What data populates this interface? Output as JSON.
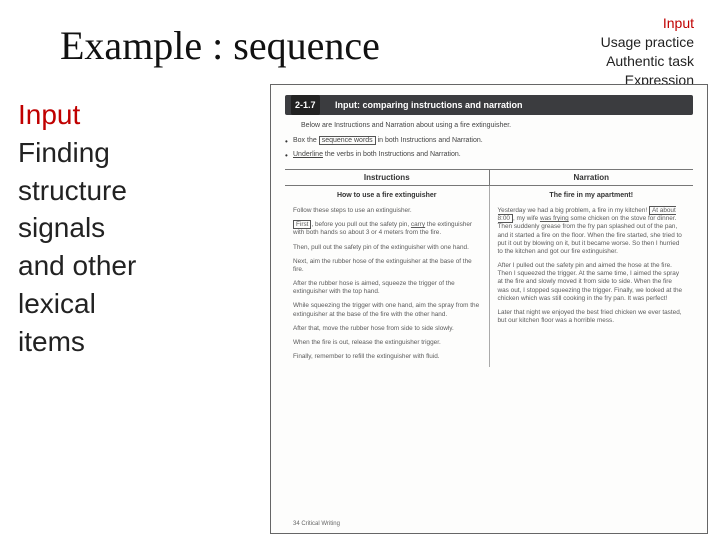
{
  "title": "Example : sequence",
  "corner": {
    "l1": "Input",
    "l2": "Usage practice",
    "l3": "Authentic task",
    "l4": "Expression"
  },
  "left": {
    "l1": "Input",
    "l2": "Finding",
    "l3": "structure",
    "l4": "signals",
    "l5": "and other",
    "l6": "lexical",
    "l7": "items"
  },
  "scan": {
    "code": "2-1.7",
    "bar_title": "Input: comparing instructions and narration",
    "intro": "Below are Instructions and Narration about using a fire extinguisher.",
    "bullet1_a": "Box the ",
    "bullet1_b": "sequence words",
    "bullet1_c": " in both Instructions and Narration.",
    "bullet2_a": "Underline",
    "bullet2_b": " the verbs in both Instructions and Narration.",
    "head_left": "Instructions",
    "head_right": "Narration",
    "sub_left": "How to use a fire extinguisher",
    "sub_right": "The fire in my apartment!",
    "left_p1": "Follow these steps to use an extinguisher.",
    "left_p2a": "First",
    "left_p2b": ", before you pull out the safety pin, ",
    "left_p2c": "carry",
    "left_p2d": " the extinguisher with both hands so about 3 or 4 meters from the fire.",
    "left_p3": "Then, pull out the safety pin of the extinguisher with one hand.",
    "left_p4": "Next, aim the rubber hose of the extinguisher at the base of the fire.",
    "left_p5": "After the rubber hose is aimed, squeeze the trigger of the extinguisher with the top hand.",
    "left_p6": "While squeezing the trigger with one hand, aim the spray from the extinguisher at the base of the fire with the other hand.",
    "left_p7": "After that, move the rubber hose from side to side slowly.",
    "left_p8": "When the fire is out, release the extinguisher trigger.",
    "left_p9": "Finally, remember to refill the extinguisher with fluid.",
    "right_p1a": "Yesterday we had a big problem, a fire in my kitchen! ",
    "right_p1b": "At about 8:00",
    "right_p1c": ", my wife ",
    "right_p1d": "was frying",
    "right_p1e": " some chicken on the stove for dinner. Then suddenly grease from the fry pan splashed out of the pan, and it started a fire on the floor. When the fire started, she tried to put it out by blowing on it, but it became worse. So then I hurried to the kitchen and got our fire extinguisher.",
    "right_p2": "After I pulled out the safety pin and aimed the hose at the fire. Then I squeezed the trigger. At the same time, I aimed the spray at the fire and slowly moved it from side to side. When the fire was out, I stopped squeezing the trigger. Finally, we looked at the chicken which was still cooking in the fry pan. It was perfect!",
    "right_p3": "Later that night we enjoyed the best fried chicken we ever tasted, but our kitchen floor was a horrible mess.",
    "page_foot": "34   Critical Writing"
  }
}
